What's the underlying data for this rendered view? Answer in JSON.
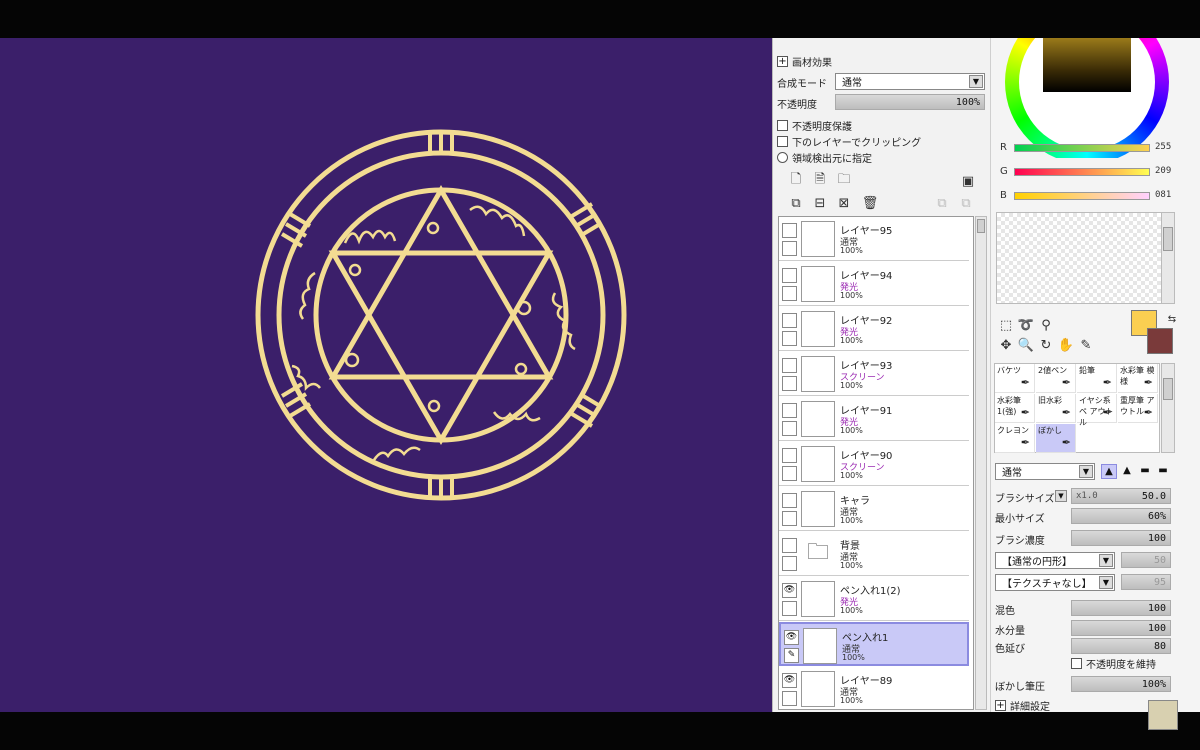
{
  "colors": {
    "canvas_bg": "#3b1f6a",
    "circle_stroke": "#f3dc92",
    "fg_color": "#fbcf51",
    "bg_color": "#7a3a3a",
    "purple_mode": "#9b2bb3"
  },
  "layer_panel": {
    "paper_effect_label": "画材効果",
    "blend_mode_label": "合成モード",
    "blend_mode_value": "通常",
    "opacity_label": "不透明度",
    "opacity_value": "100%",
    "protect_opacity_label": "不透明度保護",
    "clip_label": "下のレイヤーでクリッピング",
    "selection_source_label": "領域検出元に指定",
    "layers": [
      {
        "name": "レイヤー95",
        "mode": "通常",
        "opacity": "100%",
        "purple": false,
        "visible": false,
        "active": false
      },
      {
        "name": "レイヤー94",
        "mode": "発光",
        "opacity": "100%",
        "purple": true,
        "visible": false,
        "active": false
      },
      {
        "name": "レイヤー92",
        "mode": "発光",
        "opacity": "100%",
        "purple": true,
        "visible": false,
        "active": false
      },
      {
        "name": "レイヤー93",
        "mode": "スクリーン",
        "opacity": "100%",
        "purple": true,
        "visible": false,
        "active": false
      },
      {
        "name": "レイヤー91",
        "mode": "発光",
        "opacity": "100%",
        "purple": true,
        "visible": false,
        "active": false
      },
      {
        "name": "レイヤー90",
        "mode": "スクリーン",
        "opacity": "100%",
        "purple": true,
        "visible": false,
        "active": false
      },
      {
        "name": "キャラ",
        "mode": "通常",
        "opacity": "100%",
        "purple": false,
        "visible": false,
        "active": false
      },
      {
        "name": "背景",
        "mode": "通常",
        "opacity": "100%",
        "purple": false,
        "visible": false,
        "active": false,
        "folder": true
      },
      {
        "name": "ペン入れ1(2)",
        "mode": "発光",
        "opacity": "100%",
        "purple": true,
        "visible": true,
        "active": false
      },
      {
        "name": "ペン入れ1",
        "mode": "通常",
        "opacity": "100%",
        "purple": false,
        "visible": true,
        "active": true
      },
      {
        "name": "レイヤー89",
        "mode": "通常",
        "opacity": "100%",
        "purple": false,
        "visible": true,
        "active": false
      }
    ]
  },
  "color_panel": {
    "r_label": "R",
    "r_value": "255",
    "g_label": "G",
    "g_value": "209",
    "b_label": "B",
    "b_value": "081"
  },
  "brushes": [
    {
      "label": "バケツ",
      "active": false
    },
    {
      "label": "2値ペン",
      "active": false
    },
    {
      "label": "鉛筆",
      "active": false
    },
    {
      "label": "水彩筆 模様",
      "active": false
    },
    {
      "label": "水彩筆 1(強)",
      "active": false
    },
    {
      "label": "旧水彩",
      "active": false
    },
    {
      "label": "イヤシ系ペ アウトル",
      "active": false
    },
    {
      "label": "重厚筆 アウトル",
      "active": false
    },
    {
      "label": "クレヨン",
      "active": false
    },
    {
      "label": "ぼかし",
      "active": true
    }
  ],
  "brush_settings": {
    "mode_value": "通常",
    "size_label": "ブラシサイズ",
    "size_multiplier": "x1.0",
    "size_value": "50.0",
    "min_size_label": "最小サイズ",
    "min_size_value": "60%",
    "density_label": "ブラシ濃度",
    "density_value": "100",
    "shape_value": "【通常の円形】",
    "shape_amount": "50",
    "texture_value": "【テクスチャなし】",
    "texture_amount": "95",
    "mix_label": "混色",
    "mix_value": "100",
    "water_label": "水分量",
    "water_value": "100",
    "stretch_label": "色延び",
    "stretch_value": "80",
    "keep_opacity_label": "不透明度を維持",
    "blur_pressure_label": "ぼかし筆圧",
    "blur_pressure_value": "100%",
    "detail_label": "詳細設定"
  }
}
